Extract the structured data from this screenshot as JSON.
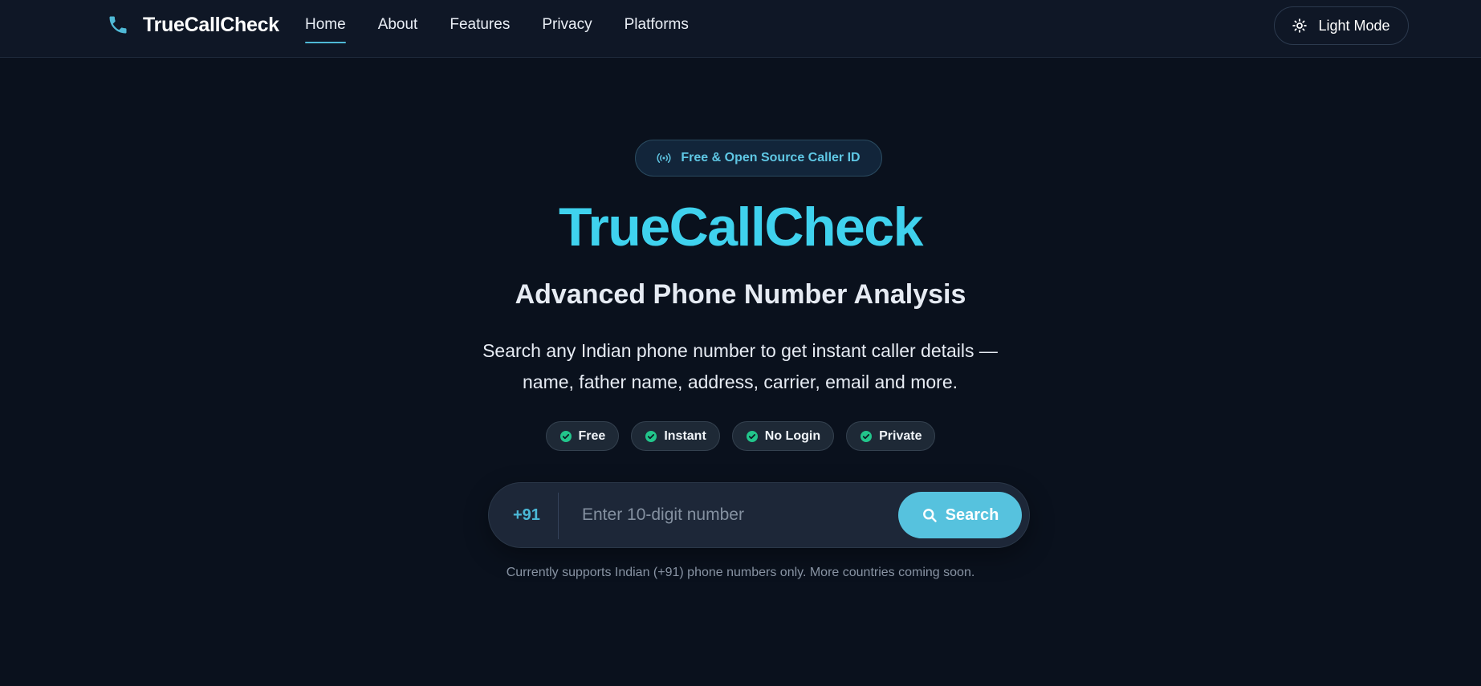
{
  "brand": {
    "name": "TrueCallCheck",
    "icon": "phone-icon"
  },
  "nav": {
    "items": [
      {
        "label": "Home",
        "active": true
      },
      {
        "label": "About",
        "active": false
      },
      {
        "label": "Features",
        "active": false
      },
      {
        "label": "Privacy",
        "active": false
      },
      {
        "label": "Platforms",
        "active": false
      }
    ]
  },
  "theme_toggle": {
    "label": "Light Mode",
    "icon": "sun-icon"
  },
  "hero": {
    "badge": {
      "label": "Free & Open Source Caller ID",
      "icon": "broadcast-icon"
    },
    "title": "TrueCallCheck",
    "subtitle": "Advanced Phone Number Analysis",
    "description": "Search any Indian phone number to get instant caller details — name, father name, address, carrier, email and more.",
    "chips": [
      {
        "label": "Free",
        "icon": "check-circle-icon"
      },
      {
        "label": "Instant",
        "icon": "check-circle-icon"
      },
      {
        "label": "No Login",
        "icon": "check-circle-icon"
      },
      {
        "label": "Private",
        "icon": "check-circle-icon"
      }
    ]
  },
  "search": {
    "prefix": "+91",
    "placeholder": "Enter 10-digit number",
    "value": "",
    "button_label": "Search",
    "button_icon": "search-icon",
    "note": "Currently supports Indian (+91) phone numbers only. More countries coming soon."
  },
  "colors": {
    "background": "#0a111d",
    "navbar": "#0f1726",
    "accent": "#3fd2ee",
    "button": "#56c2de",
    "check": "#22c58b"
  }
}
